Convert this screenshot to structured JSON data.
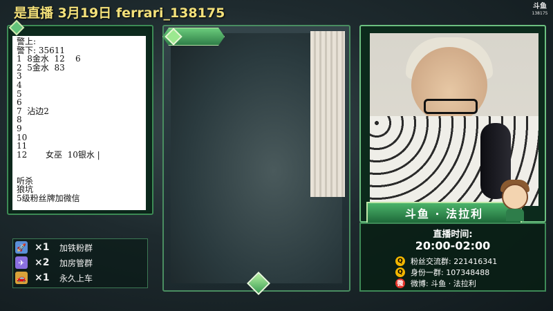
{
  "header": {
    "title": "是直播  3月19日 ferrari_138175",
    "logo_text": "斗鱼",
    "logo_id": "138175"
  },
  "notes": {
    "lines": [
      "警上:",
      "警下: 35611",
      "1  8金水  12    6",
      "2  5金水  83",
      "3",
      "4",
      "5",
      "6",
      "7  沾边2",
      "8",
      "9",
      "10",
      "11",
      "12       女巫  10银水 |",
      "",
      "",
      "听杀",
      "狼坑",
      "5级粉丝牌加微信"
    ]
  },
  "rewards": [
    {
      "icon": "rocket-icon",
      "qty": "×1",
      "desc": "加铁粉群",
      "color": "#5b8fd8"
    },
    {
      "icon": "plane-icon",
      "qty": "×2",
      "desc": "加房管群",
      "color": "#8a6fe0"
    },
    {
      "icon": "car-icon",
      "qty": "×1",
      "desc": "永久上车",
      "color": "#d8a23a"
    }
  ],
  "streamer": {
    "name_banner": "斗鱼 · 法拉利",
    "live_label": "直播时间:",
    "live_time": "20:00-02:00",
    "contacts": [
      {
        "icon": "qq-icon",
        "text": "粉丝交流群: 221416341",
        "color": "#f2b600"
      },
      {
        "icon": "qq-icon",
        "text": "身份一群: 107348488",
        "color": "#f2b600"
      },
      {
        "icon": "weibo-icon",
        "text": "微博: 斗鱼 · 法拉利",
        "color": "#e5332a"
      }
    ]
  }
}
